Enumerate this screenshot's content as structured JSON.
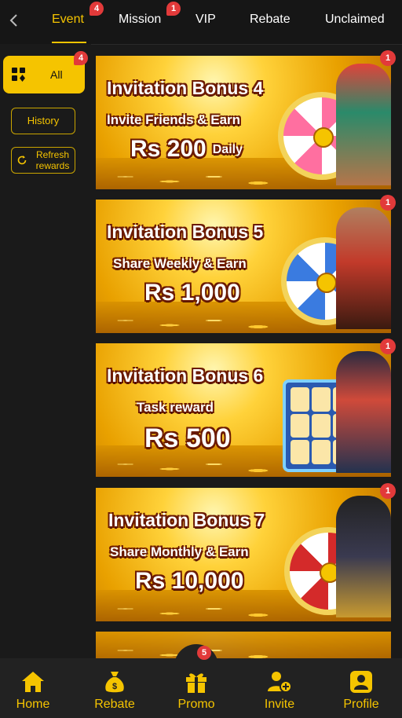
{
  "tabs": [
    {
      "label": "Event",
      "badge": "4",
      "active": true
    },
    {
      "label": "Mission",
      "badge": "1"
    },
    {
      "label": "VIP"
    },
    {
      "label": "Rebate"
    },
    {
      "label": "Unclaimed"
    }
  ],
  "sidebar": {
    "all_label": "All",
    "all_badge": "4",
    "history_label": "History",
    "refresh_label": "Refresh rewards"
  },
  "banners": [
    {
      "title": "Invitation Bonus 4",
      "subtitle": "Invite Friends & Earn",
      "amount": "Rs 200",
      "suffix": "Daily",
      "badge": "1"
    },
    {
      "title": "Invitation Bonus 5",
      "subtitle": "Share Weekly & Earn",
      "amount": "Rs 1,000",
      "badge": "1"
    },
    {
      "title": "Invitation Bonus 6",
      "subtitle": "Task reward",
      "amount": "Rs 500",
      "badge": "1"
    },
    {
      "title": "Invitation Bonus 7",
      "subtitle": "Share Monthly & Earn",
      "amount": "Rs 10,000",
      "badge": "1"
    }
  ],
  "bottom_nav": [
    {
      "label": "Home",
      "icon": "home-icon"
    },
    {
      "label": "Rebate",
      "icon": "money-bag-icon"
    },
    {
      "label": "Promo",
      "icon": "gift-icon",
      "badge": "5"
    },
    {
      "label": "Invite",
      "icon": "add-user-icon"
    },
    {
      "label": "Profile",
      "icon": "profile-icon"
    }
  ],
  "colors": {
    "accent": "#f5c400",
    "badge": "#e23a3a",
    "background": "#1a1a1a"
  }
}
